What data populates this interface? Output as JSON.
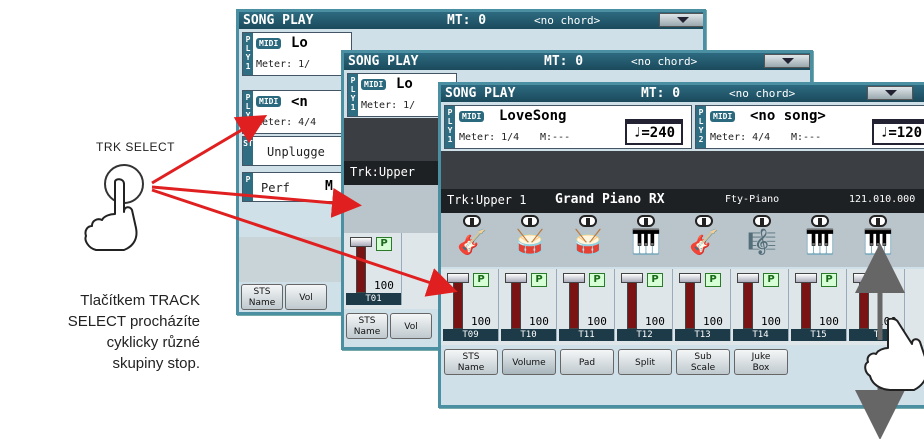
{
  "header": {
    "title": "SONG PLAY",
    "mt": "MT: 0",
    "chord": "<no chord>"
  },
  "player1": {
    "tag": "PLY1",
    "midi": "MIDI",
    "song": "LoveSong",
    "meter": "Meter: 1/4",
    "measure": "M:---",
    "tempo": "♩=240"
  },
  "player2": {
    "tag": "PLY2",
    "midi": "MIDI",
    "song": "<no song>",
    "meter": "Meter: 4/4",
    "measure": "M:---",
    "tempo": "♩=120"
  },
  "track_bar": {
    "name": "Trk:Upper 1",
    "sound": "Grand Piano RX",
    "category": "Fty-Piano",
    "bank": "121.010.000"
  },
  "mid_panel": {
    "track": "Trk:Upper",
    "first_track": "T01",
    "tab0": "STS Name",
    "tab1": "Vol"
  },
  "back_panel": {
    "ply2_song": "<n",
    "meter": "Meter: 4/4",
    "style": "Unplugge",
    "perf": "Perf",
    "perf_value": "M",
    "meter1": "Meter: 1/",
    "song": "Lo",
    "tag_st": "ST",
    "tag_p": "P",
    "tab0": "STS Name",
    "tab1": "Vol"
  },
  "tracks": [
    {
      "icon": "guitar-icon",
      "glyph": "🎸",
      "number": "T09",
      "volume": "100",
      "play": "P"
    },
    {
      "icon": "drum-kit-icon",
      "glyph": "🥁",
      "number": "T10",
      "volume": "100",
      "play": "P"
    },
    {
      "icon": "drum-kit-icon",
      "glyph": "🥁",
      "number": "T11",
      "volume": "100",
      "play": "P"
    },
    {
      "icon": "grand-piano-icon",
      "glyph": "🎹",
      "number": "T12",
      "volume": "100",
      "play": "P"
    },
    {
      "icon": "guitar-icon",
      "glyph": "🎸",
      "number": "T13",
      "volume": "100",
      "play": "P"
    },
    {
      "icon": "vibraphone-icon",
      "glyph": "🎼",
      "number": "T14",
      "volume": "100",
      "play": "P"
    },
    {
      "icon": "upright-piano-icon",
      "glyph": "🎹",
      "number": "T15",
      "volume": "100",
      "play": "P"
    },
    {
      "icon": "grand-piano-icon",
      "glyph": "🎹",
      "number": "T",
      "volume": "100",
      "play": "P"
    }
  ],
  "tabs": [
    {
      "name": "tab-sts-name",
      "label": "STS\nName"
    },
    {
      "name": "tab-volume",
      "label": "Volume"
    },
    {
      "name": "tab-pad",
      "label": "Pad"
    },
    {
      "name": "tab-split",
      "label": "Split"
    },
    {
      "name": "tab-sub-scale",
      "label": "Sub\nScale"
    },
    {
      "name": "tab-juke-box",
      "label": "Juke\nBox"
    }
  ],
  "annotation": {
    "button_label": "TRK SELECT",
    "caption": "Tlačítkem TRACK SELECT procházíte cyklicky různé skupiny stop.",
    "caption_lines": [
      "Tlačítkem TRACK",
      "SELECT procházíte",
      "cyklicky různé",
      "skupiny stop."
    ]
  },
  "colors": {
    "header": "#1b4a5c",
    "panel_border": "#4b8fa3",
    "arrow": "#e02020",
    "fader": "#7a1414"
  }
}
